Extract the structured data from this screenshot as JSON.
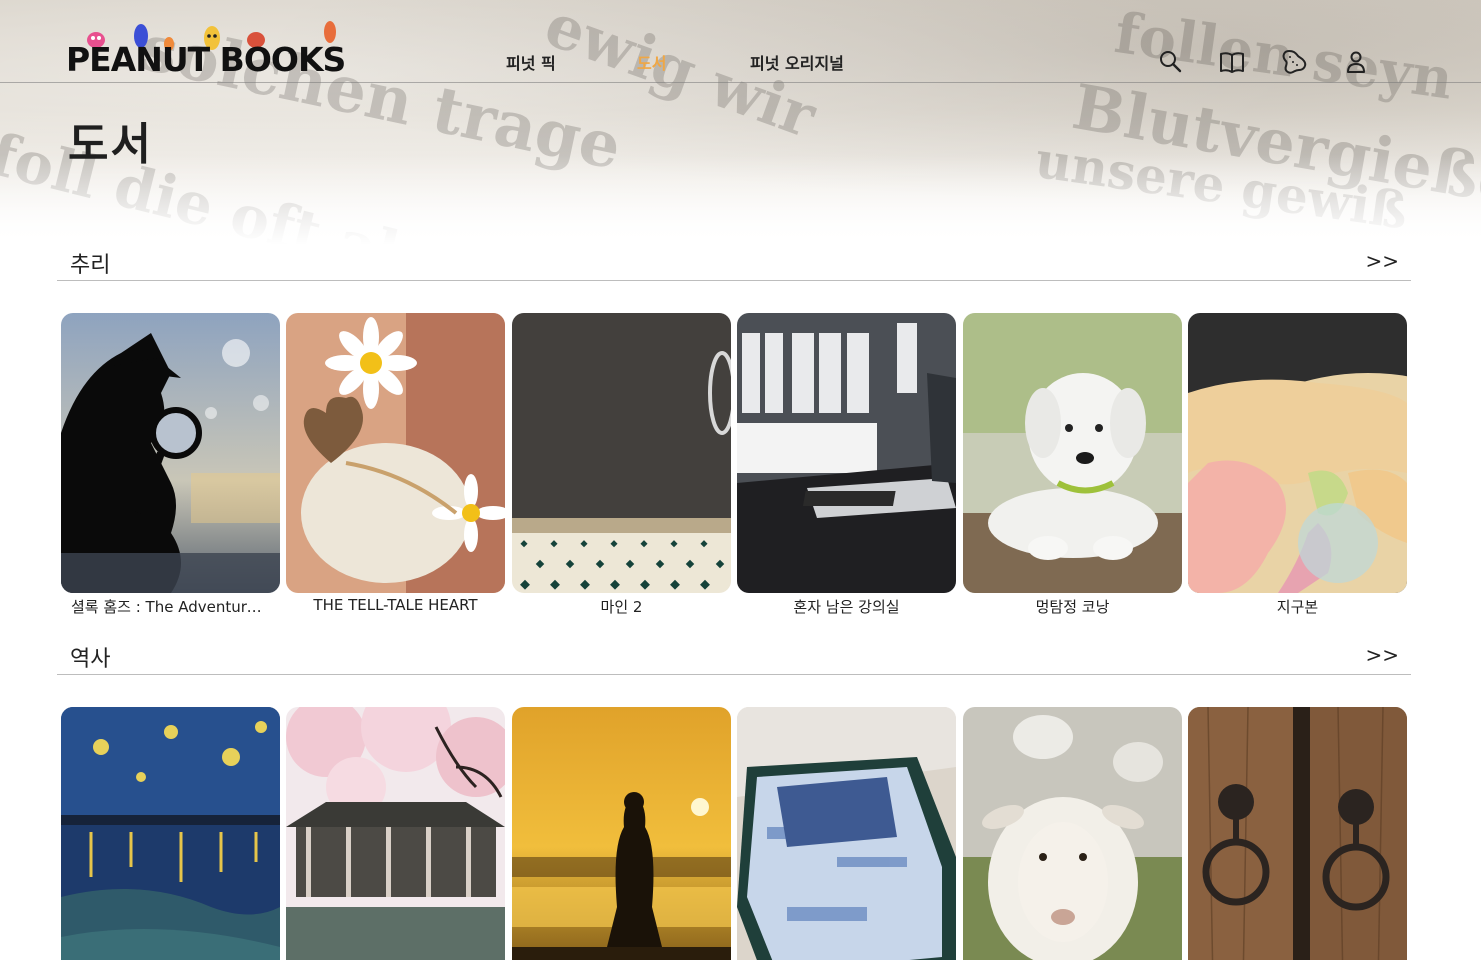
{
  "header": {
    "logo_text": "PEANUT BOOKS",
    "nav": [
      {
        "label": "피넛 픽",
        "active": false
      },
      {
        "label": "도서",
        "active": true
      },
      {
        "label": "피넛 오리지널",
        "active": false
      }
    ],
    "icons": [
      "search-icon",
      "book-icon",
      "peanut-icon",
      "user-icon"
    ],
    "active_color": "#f0a744"
  },
  "page": {
    "title": "도서"
  },
  "sections": [
    {
      "title": "추리",
      "more_label": ">>",
      "books": [
        {
          "title": "셜록 홈즈 : The Adventures of Sherlock Holmes",
          "image": "detective-silhouette"
        },
        {
          "title": "THE TELL-TALE HEART",
          "image": "daisy-heart"
        },
        {
          "title": "마인 2",
          "image": "dark-room-tiles"
        },
        {
          "title": "혼자 남은 강의실",
          "image": "laptop-desk"
        },
        {
          "title": "멍탐정 코낭",
          "image": "white-puppy"
        },
        {
          "title": "지구본",
          "image": "globe-map"
        }
      ]
    },
    {
      "title": "역사",
      "more_label": ">>",
      "books": [
        {
          "title": "",
          "image": "starry-night"
        },
        {
          "title": "",
          "image": "cherry-blossom-pavilion"
        },
        {
          "title": "",
          "image": "sunset-silhouette"
        },
        {
          "title": "",
          "image": "folded-cloth"
        },
        {
          "title": "",
          "image": "sheep"
        },
        {
          "title": "",
          "image": "wooden-door-rings"
        }
      ]
    }
  ]
}
